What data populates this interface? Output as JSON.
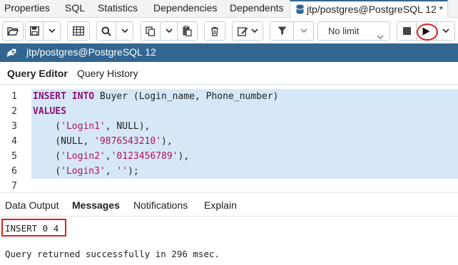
{
  "tabs": {
    "properties": "Properties",
    "sql": "SQL",
    "statistics": "Statistics",
    "dependencies": "Dependencies",
    "dependents": "Dependents",
    "query_tool": "jtp/postgres@PostgreSQL 12 *"
  },
  "toolbar": {
    "limit_value": "No limit"
  },
  "connection": {
    "label": "jtp/postgres@PostgreSQL 12"
  },
  "editor_tabs": {
    "query_editor": "Query Editor",
    "query_history": "Query History"
  },
  "editor": {
    "line_numbers": [
      "1",
      "2",
      "3",
      "4",
      "5",
      "6",
      "7"
    ]
  },
  "results_tabs": {
    "data_output": "Data Output",
    "messages": "Messages",
    "notifications": "Notifications",
    "explain": "Explain"
  },
  "messages": {
    "result": "INSERT 0 4",
    "status": "Query returned successfully in 296 msec."
  },
  "colors": {
    "accent": "#326690",
    "selection": "#d6e8f7",
    "keyword": "#90107c",
    "string": "#b0125f",
    "annotation": "#dd2222"
  }
}
